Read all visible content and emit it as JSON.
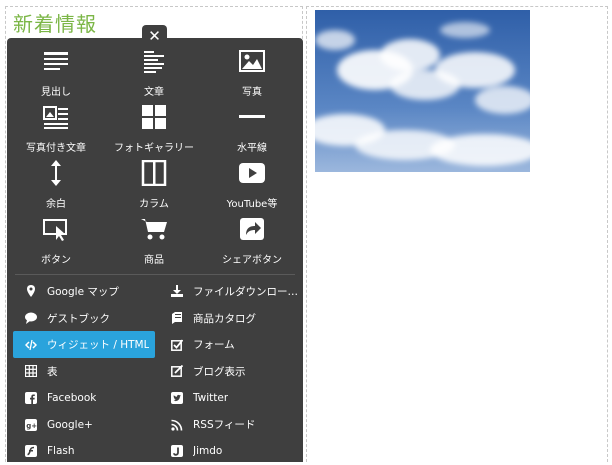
{
  "heading": "新着情報",
  "close_label": "✕",
  "accent_color": "#2aa3dc",
  "panel_color": "#3f3f3f",
  "tiles": [
    {
      "label": "見出し",
      "icon": "heading-icon"
    },
    {
      "label": "文章",
      "icon": "text-icon"
    },
    {
      "label": "写真",
      "icon": "photo-icon"
    },
    {
      "label": "写真付き文章",
      "icon": "photo-text-icon"
    },
    {
      "label": "フォトギャラリー",
      "icon": "gallery-icon"
    },
    {
      "label": "水平線",
      "icon": "horizontal-line-icon"
    },
    {
      "label": "余白",
      "icon": "spacing-icon"
    },
    {
      "label": "カラム",
      "icon": "column-icon"
    },
    {
      "label": "YouTube等",
      "icon": "video-icon"
    },
    {
      "label": "ボタン",
      "icon": "button-icon"
    },
    {
      "label": "商品",
      "icon": "cart-icon"
    },
    {
      "label": "シェアボタン",
      "icon": "share-icon"
    }
  ],
  "list": [
    {
      "label": "Google マップ",
      "icon": "map-pin-icon"
    },
    {
      "label": "ファイルダウンロー…",
      "icon": "download-icon"
    },
    {
      "label": "ゲストブック",
      "icon": "speech-bubble-icon"
    },
    {
      "label": "商品カタログ",
      "icon": "book-icon"
    },
    {
      "label": "ウィジェット / HTML",
      "icon": "code-icon",
      "active": true
    },
    {
      "label": "フォーム",
      "icon": "checkbox-icon"
    },
    {
      "label": "表",
      "icon": "table-icon"
    },
    {
      "label": "ブログ表示",
      "icon": "edit-icon"
    },
    {
      "label": "Facebook",
      "icon": "facebook-icon"
    },
    {
      "label": "Twitter",
      "icon": "twitter-icon"
    },
    {
      "label": "Google+",
      "icon": "google-plus-icon"
    },
    {
      "label": "RSSフィード",
      "icon": "rss-icon"
    },
    {
      "label": "Flash",
      "icon": "flash-icon"
    },
    {
      "label": "Jimdo",
      "icon": "jimdo-icon"
    }
  ]
}
